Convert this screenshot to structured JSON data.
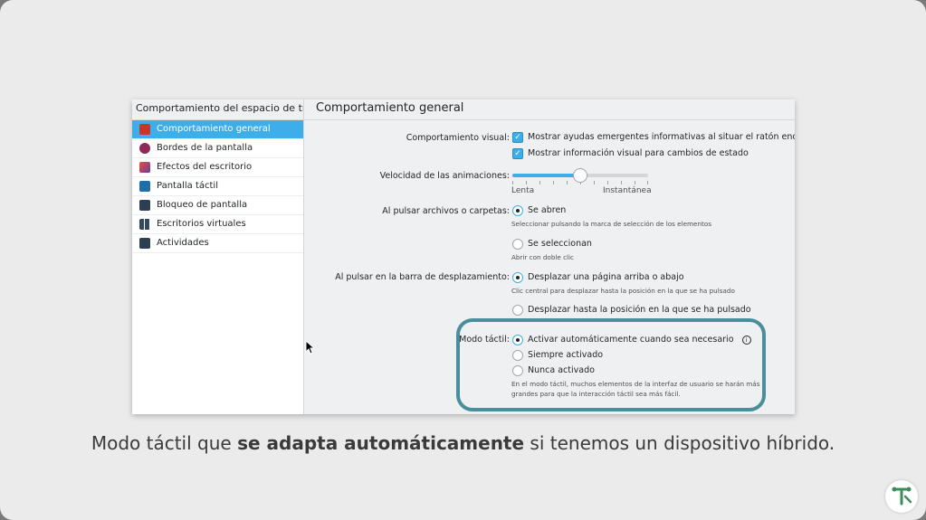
{
  "sidebar": {
    "header": "Comportamiento del espacio de tr...",
    "items": [
      {
        "label": "Comportamiento general",
        "icon": "general-behaviour-icon",
        "color": "#c0392b"
      },
      {
        "label": "Bordes de la pantalla",
        "icon": "screen-edges-icon",
        "color": "#8e2a5a"
      },
      {
        "label": "Efectos del escritorio",
        "icon": "desktop-effects-icon",
        "color": "#6a3d9a"
      },
      {
        "label": "Pantalla táctil",
        "icon": "touch-screen-icon",
        "color": "#1e6fa8"
      },
      {
        "label": "Bloqueo de pantalla",
        "icon": "screen-lock-icon",
        "color": "#2c3e50"
      },
      {
        "label": "Escritorios virtuales",
        "icon": "virtual-desktops-icon",
        "color": "#34495e"
      },
      {
        "label": "Actividades",
        "icon": "activities-icon",
        "color": "#2c3e50"
      }
    ]
  },
  "main": {
    "title": "Comportamiento general",
    "visual": {
      "label": "Comportamiento visual:",
      "opt1": "Mostrar ayudas emergentes informativas al situar el ratón encima",
      "opt2": "Mostrar información visual para cambios de estado"
    },
    "animation": {
      "label": "Velocidad de las animaciones:",
      "min_label": "Lenta",
      "max_label": "Instantánea",
      "value_fraction": 0.5
    },
    "files": {
      "label": "Al pulsar archivos o carpetas:",
      "opt1": "Se abren",
      "hint1": "Seleccionar pulsando la marca de selección de los elementos",
      "opt2": "Se seleccionan",
      "hint2": "Abrir con doble clic"
    },
    "scrollbar": {
      "label": "Al pulsar en la barra de desplazamiento:",
      "opt1": "Desplazar una página arriba o abajo",
      "hint1": "Clic central para desplazar hasta la posición en la que se ha pulsado",
      "opt2": "Desplazar hasta la posición en la que se ha pulsado"
    },
    "touch": {
      "label": "Modo táctil:",
      "opt1": "Activar automáticamente cuando sea necesario",
      "opt2": "Siempre activado",
      "opt3": "Nunca activado",
      "hint_line1": "En el modo táctil, muchos elementos de la interfaz de usuario se harán más",
      "hint_line2": "grandes para que la interacción táctil sea más fácil."
    }
  },
  "caption": {
    "before": "Modo táctil que ",
    "bold": "se adapta automáticamente",
    "after": " si tenemos un dispositivo híbrido."
  },
  "colors": {
    "accent": "#3daee9",
    "highlight_border": "#4a8e9c"
  }
}
